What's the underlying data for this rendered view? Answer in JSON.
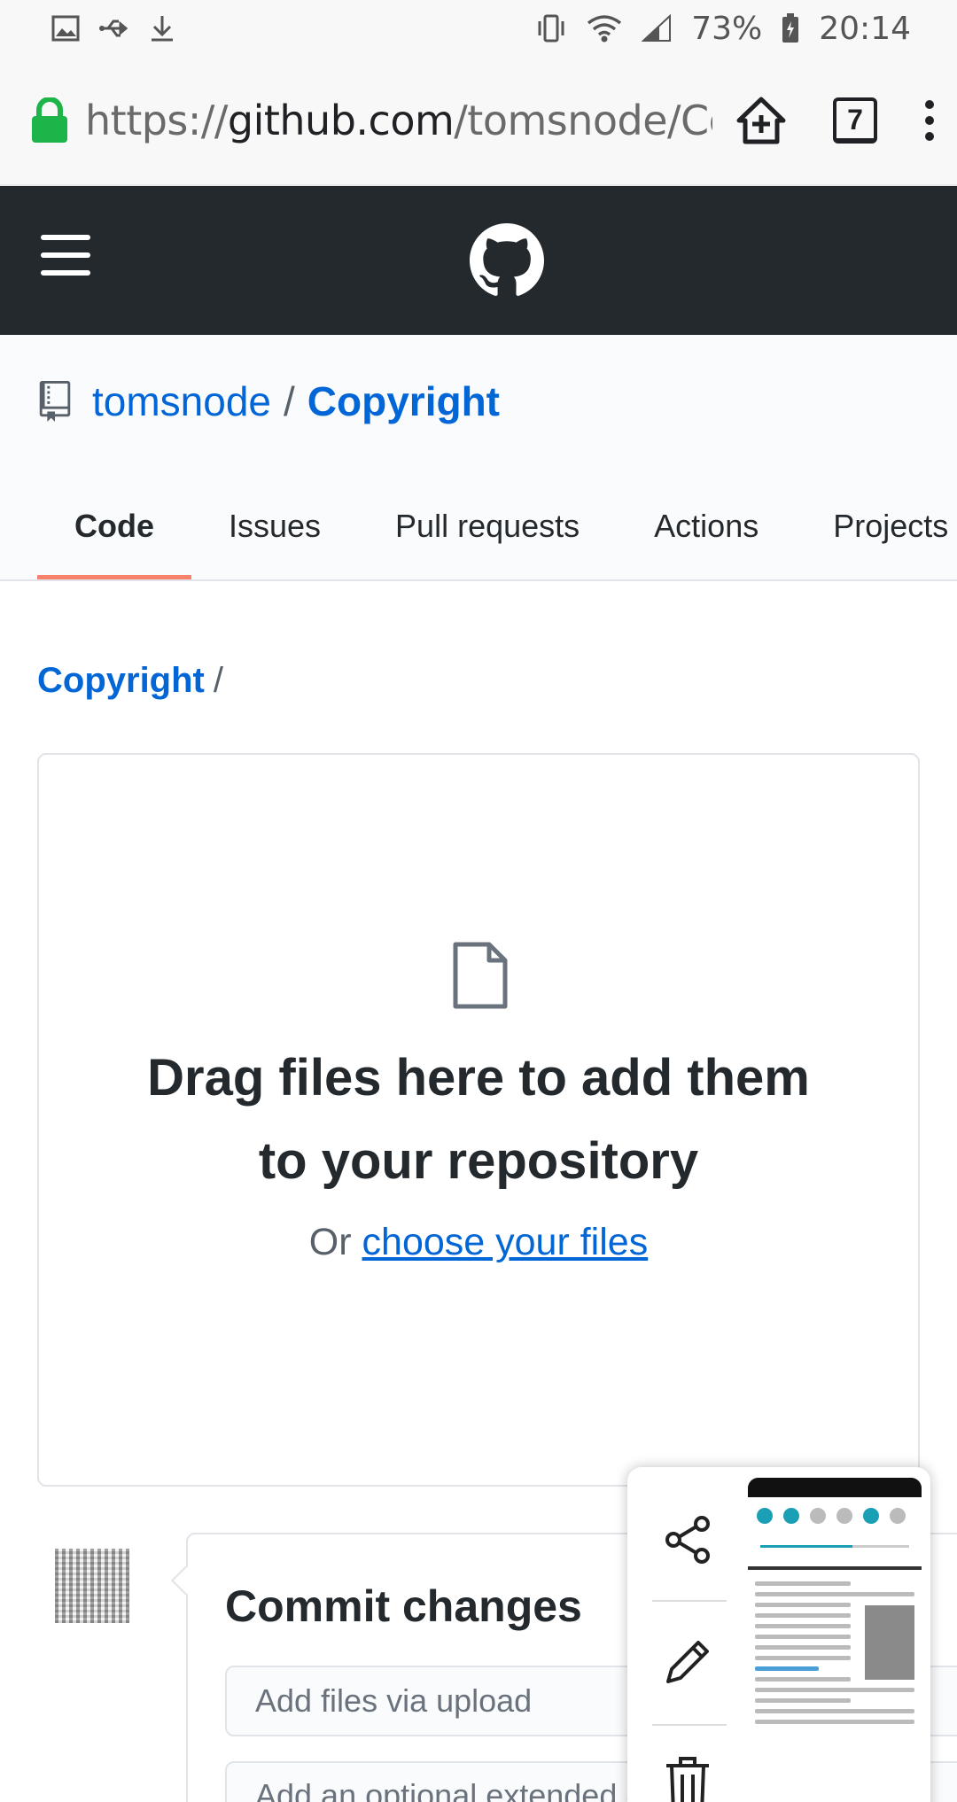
{
  "status_bar": {
    "battery": "73%",
    "time": "20:14"
  },
  "browser": {
    "url_scheme": "https://",
    "url_host": "github.com",
    "url_path": "/tomsnode/Co",
    "tab_count": "7"
  },
  "repo": {
    "owner": "tomsnode",
    "separator": "/",
    "name": "Copyright",
    "tabs": [
      "Code",
      "Issues",
      "Pull requests",
      "Actions",
      "Projects"
    ]
  },
  "breadcrumb": {
    "root": "Copyright",
    "separator": "/"
  },
  "dropzone": {
    "title": "Drag files here to add them to your repository",
    "or_text": "Or",
    "choose_link": "choose your files"
  },
  "commit": {
    "title": "Commit changes",
    "summary_placeholder": "Add files via upload",
    "description_placeholder": "Add an optional extended description..."
  },
  "colors": {
    "header_bg": "#24292e",
    "link": "#0366d6",
    "active_tab_underline": "#f9826c",
    "lock": "#1db44a"
  }
}
